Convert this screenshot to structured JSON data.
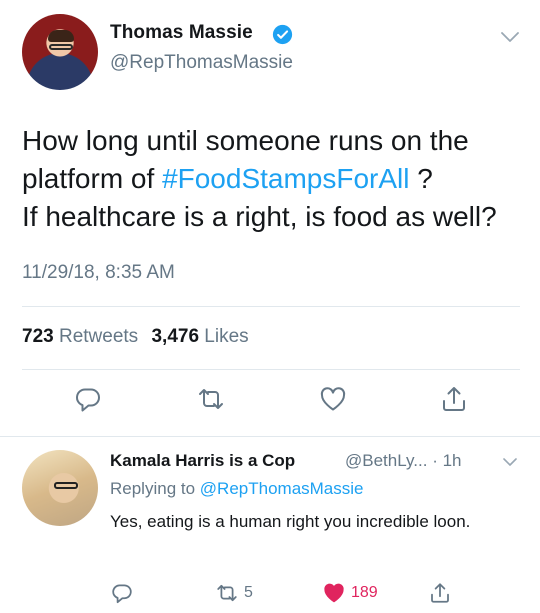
{
  "tweet": {
    "author_name": "Thomas Massie",
    "author_handle": "@RepThomasMassie",
    "verified": true,
    "text_before_hashtag_1": "How long until someone runs on the",
    "text_before_hashtag_2": "platform of ",
    "hashtag": "#FoodStampsForAll",
    "text_after_hashtag": " ?",
    "text_line_3": "If healthcare is a right, is food as well?",
    "timestamp": "11/29/18, 8:35 AM",
    "retweets_count": "723",
    "retweets_label": "Retweets",
    "likes_count": "3,476",
    "likes_label": "Likes",
    "actions": [
      "reply-icon",
      "retweet-icon",
      "like-icon",
      "share-icon"
    ]
  },
  "reply": {
    "author_name": "Kamala Harris is a Cop",
    "author_handle": "@BethLy...",
    "time": "· 1h",
    "replying_to_label": "Replying to",
    "replying_to_handle": "@RepThomasMassie",
    "text": "Yes, eating is a human right you incredible loon.",
    "retweet_count": "5",
    "like_count": "189",
    "liked": true
  },
  "colors": {
    "link": "#1da1f2",
    "secondary_text": "#657786",
    "like_active": "#e0245e",
    "divider": "#e1e8ed"
  }
}
